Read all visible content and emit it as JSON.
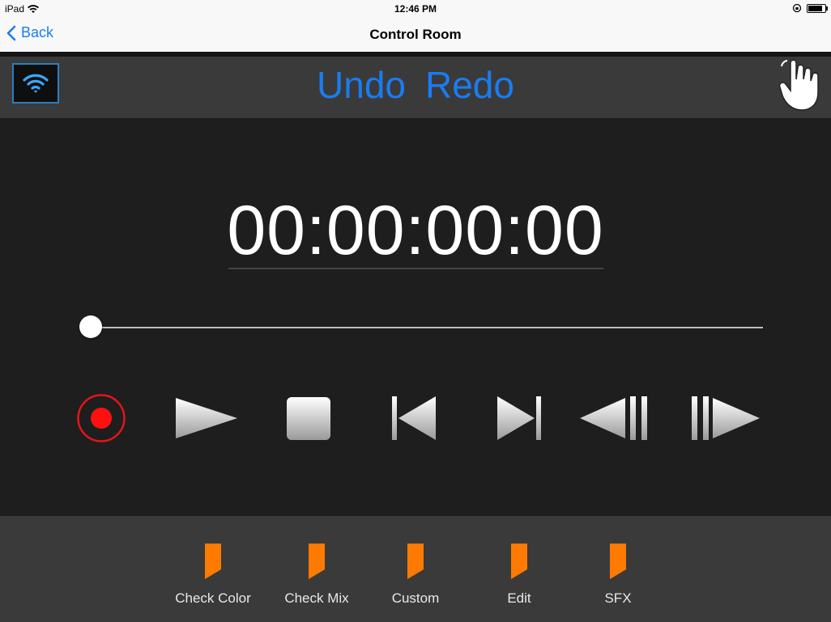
{
  "status_bar": {
    "device": "iPad",
    "time": "12:46 PM",
    "wifi_icon": "wifi-icon",
    "battery_fill": 0.85
  },
  "nav": {
    "back_label": "Back",
    "title": "Control Room"
  },
  "toolbar": {
    "undo_label": "Undo",
    "redo_label": "Redo",
    "accent_color": "#1a7cf0"
  },
  "main": {
    "timecode": "00:00:00:00",
    "scrub_position": 0
  },
  "transport": {
    "buttons": [
      "record",
      "play",
      "stop",
      "skip-to-start",
      "skip-to-end",
      "step-backward",
      "step-forward"
    ]
  },
  "markers": [
    {
      "label": "Check Color"
    },
    {
      "label": "Check Mix"
    },
    {
      "label": "Custom"
    },
    {
      "label": "Edit"
    },
    {
      "label": "SFX"
    }
  ],
  "colors": {
    "marker_orange": "#ff7a00",
    "record_red": "#e5141a",
    "background": "#1e1e1e"
  }
}
